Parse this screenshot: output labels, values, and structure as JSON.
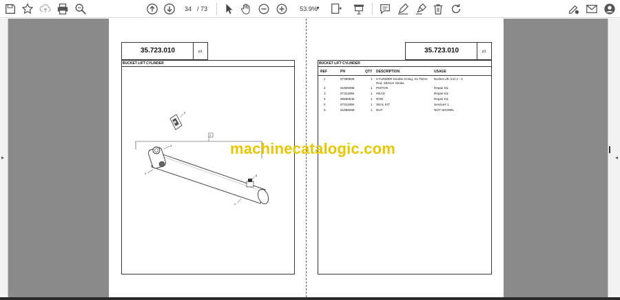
{
  "toolbar": {
    "page_current": "34",
    "page_total": "/ 73",
    "zoom": "53.9%",
    "icons": [
      "save-icon",
      "bookmark-star-icon",
      "upload-icon",
      "print-icon",
      "search-zoom-icon",
      "prev-page-icon",
      "next-page-icon",
      "select-cursor-icon",
      "hand-pan-icon",
      "zoom-out-icon",
      "zoom-in-icon",
      "fit-page-icon",
      "presentation-icon",
      "comment-icon",
      "draw-pen-icon",
      "highlight-icon",
      "delete-icon",
      "rotate-icon",
      "fill-sign-icon",
      "email-icon",
      "account-icon"
    ]
  },
  "left_page": {
    "doc_number": "35.723.010",
    "page_ref": "p1",
    "title": "BUCKET LIFT CYLINDER",
    "callouts": [
      "1",
      "2",
      "3",
      "4",
      "5",
      "6"
    ]
  },
  "right_page": {
    "doc_number": "35.723.010",
    "page_ref": "p1",
    "title": "BUCKET LIFT CYLINDER",
    "columns": [
      "REF",
      "PN",
      "QTY",
      "DESCRIPTION",
      "USAGE"
    ],
    "rows": [
      {
        "ref": "1",
        "pn": "87399606",
        "qty": "1",
        "desc": "CYLINDER Double Acting, 31.75mm Rod, 484mm Stroke",
        "usage": "Bucket Lift, Incl 2 - 4."
      },
      {
        "ref": "2",
        "pn": "51856095",
        "qty": "1",
        "desc": "PISTON",
        "usage": "Repair Kit."
      },
      {
        "ref": "3",
        "pn": "87311856",
        "qty": "1",
        "desc": "HEAD",
        "usage": "Repair Kit."
      },
      {
        "ref": "4",
        "pn": "86580645",
        "qty": "1",
        "desc": "ROD",
        "usage": "Repair Kit."
      },
      {
        "ref": "5",
        "pn": "87311856",
        "qty": "1",
        "desc": "SEAL KIT",
        "usage": "Services 1."
      },
      {
        "ref": "6",
        "pn": "51856098",
        "qty": "1",
        "desc": "NUT",
        "usage": "NOT SHOWN."
      }
    ]
  },
  "watermark": "machinecatalogic.com"
}
